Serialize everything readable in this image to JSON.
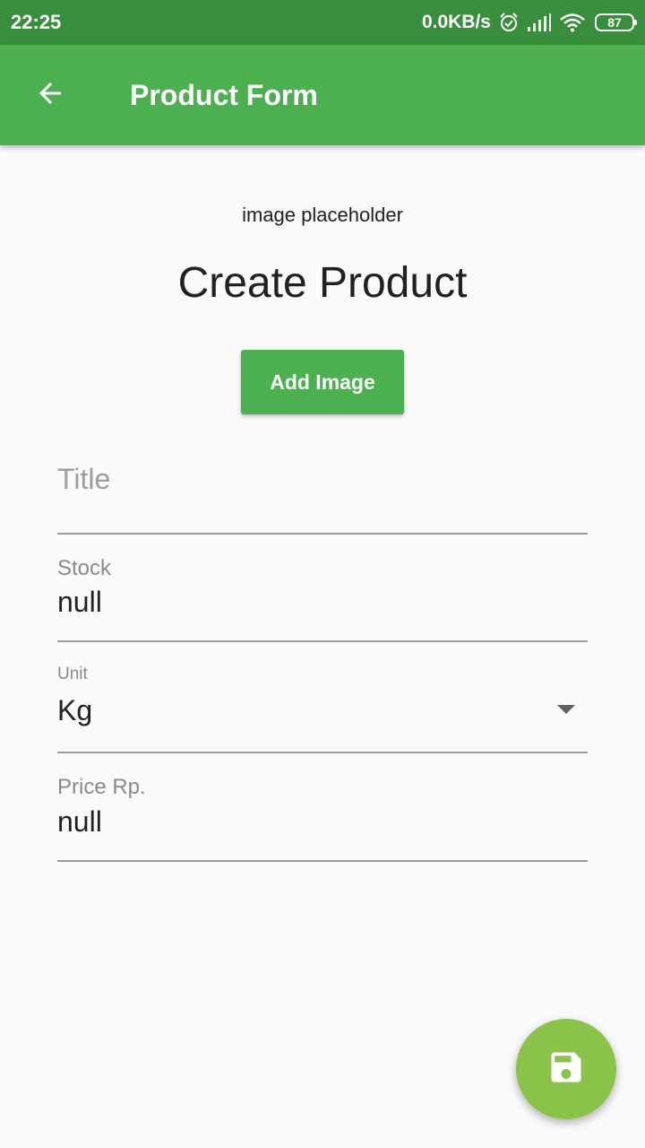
{
  "status_bar": {
    "time": "22:25",
    "network_speed": "0.0KB/s",
    "battery_level": "87",
    "icons": [
      "alarm-icon",
      "signal-icon",
      "wifi-icon",
      "battery-icon"
    ]
  },
  "app_bar": {
    "title": "Product Form",
    "back_icon": "arrow-back-icon",
    "color": "#4caf50"
  },
  "content": {
    "image_placeholder": "image placeholder",
    "heading": "Create Product",
    "add_image_label": "Add Image"
  },
  "form": {
    "title": {
      "placeholder": "Title",
      "value": ""
    },
    "stock": {
      "label": "Stock",
      "value": "null"
    },
    "unit": {
      "label": "Unit",
      "selected": "Kg"
    },
    "price": {
      "label": "Price Rp.",
      "value": "null"
    }
  },
  "fab": {
    "icon": "save-icon",
    "color": "#8bc34a"
  }
}
